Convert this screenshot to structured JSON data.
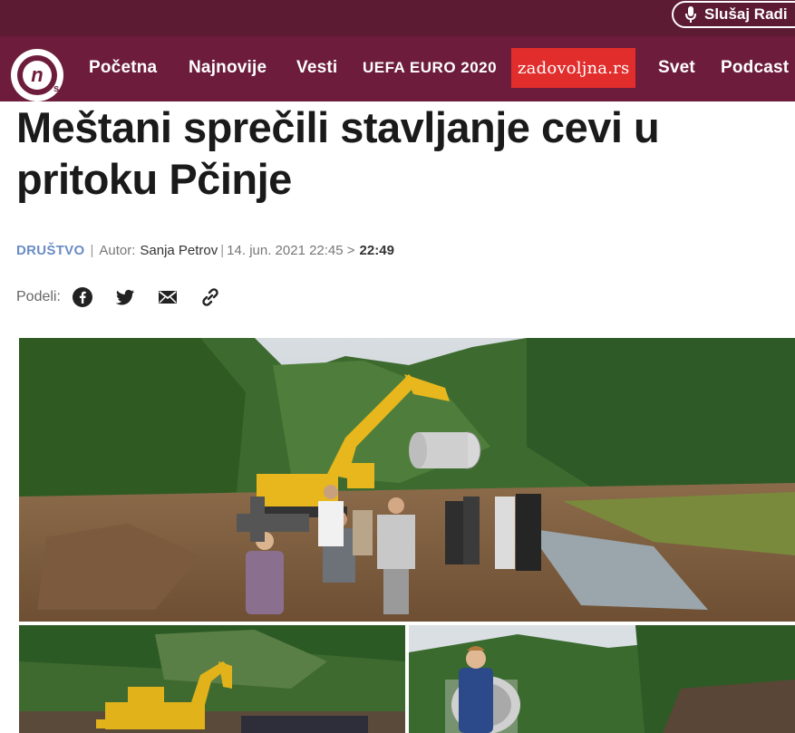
{
  "header": {
    "radio_label": "Slušaj Radi",
    "logo_text": "n",
    "logo_sub": "s",
    "nav": [
      {
        "label": "Početna"
      },
      {
        "label": "Najnovije"
      },
      {
        "label": "Vesti"
      },
      {
        "label": "UEFA EURO 2020"
      },
      {
        "label": "zadovoljna.rs"
      },
      {
        "label": "Svet"
      },
      {
        "label": "Podcast"
      }
    ]
  },
  "article": {
    "title": "Meštani sprečili stavljanje cevi u pritoku Pčinje",
    "category": "DRUŠTVO",
    "author_label": "Autor:",
    "author": "Sanja Petrov",
    "published": "14. jun. 2021 22:45 >",
    "updated": "22:49",
    "share_label": "Podeli:"
  },
  "icons": {
    "facebook": "facebook-icon",
    "twitter": "twitter-icon",
    "email": "email-icon",
    "link": "link-icon",
    "mic": "microphone-icon"
  },
  "colors": {
    "header_bg": "#6d1d3b",
    "topbar_bg": "#5c1a33",
    "accent_red": "#e22d2d",
    "category": "#6b8cc5"
  }
}
